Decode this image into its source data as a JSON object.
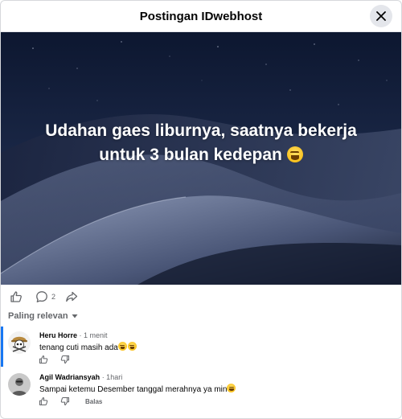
{
  "header": {
    "title": "Postingan IDwebhost"
  },
  "post": {
    "caption_line1": "Udahan gaes liburnya, saatnya bekerja",
    "caption_line2": "untuk 3 bulan kedepan"
  },
  "actions": {
    "comment_count": "2"
  },
  "comments_filter": {
    "label": "Paling relevan"
  },
  "comments": [
    {
      "author": "Heru Horre",
      "time": " · 1 menit",
      "text": "tenang cuti masih ada"
    },
    {
      "author": "Agil Wadriansyah",
      "time": " · 1hari",
      "text": "Sampai ketemu Desember tanggal merahnya ya min",
      "reply_label": "Balas"
    }
  ],
  "colors": {
    "accent": "#1877f2",
    "muted": "#65676b",
    "sky": "#0f1a33"
  }
}
